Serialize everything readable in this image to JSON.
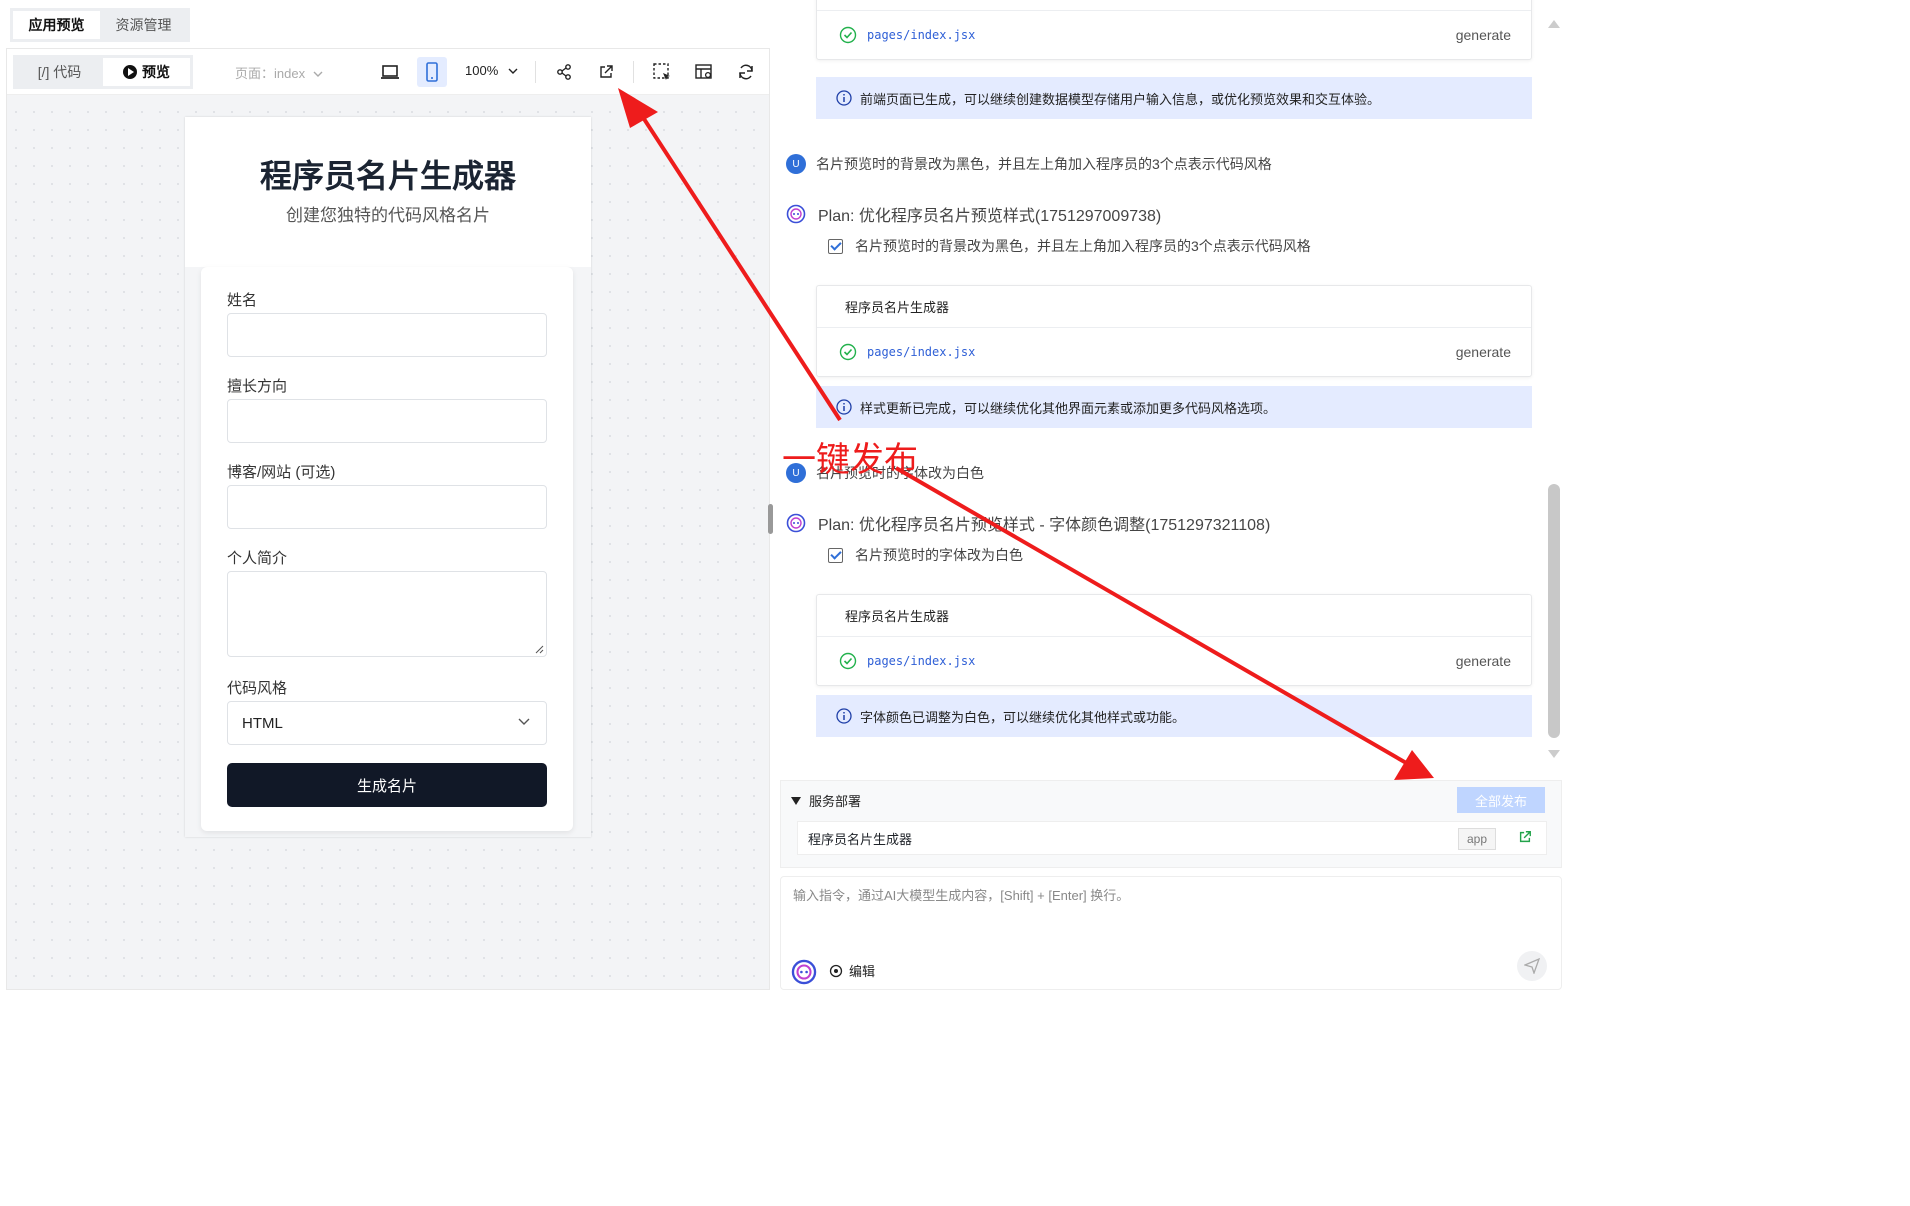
{
  "top_tabs": [
    "应用预览",
    "资源管理"
  ],
  "toolbar": {
    "code_label": "[/] 代码",
    "preview_label": "预览",
    "page_select": "页面：index",
    "zoom": "100%"
  },
  "preview": {
    "title": "程序员名片生成器",
    "subtitle": "创建您独特的代码风格名片",
    "fields": {
      "name": "姓名",
      "specialty": "擅长方向",
      "blog": "博客/网站 (可选)",
      "bio": "个人简介",
      "style": "代码风格"
    },
    "style_value": "HTML",
    "button": "生成名片"
  },
  "chat": {
    "card_title": "程序员名片生成器",
    "file": "pages/index.jsx",
    "generate": "generate",
    "info1": "前端页面已生成，可以继续创建数据模型存储用户输入信息，或优化预览效果和交互体验。",
    "user1": "名片预览时的背景改为黑色，并且左上角加入程序员的3个点表示代码风格",
    "plan1": "Plan: 优化程序员名片预览样式(1751297009738)",
    "task1": "名片预览时的背景改为黑色，并且左上角加入程序员的3个点表示代码风格",
    "info2": "样式更新已完成，可以继续优化其他界面元素或添加更多代码风格选项。",
    "user2": "名片预览时的字体改为白色",
    "plan2": "Plan: 优化程序员名片预览样式 - 字体颜色调整(1751297321108)",
    "task2": "名片预览时的字体改为白色",
    "info3": "字体颜色已调整为白色，可以继续优化其他样式或功能。",
    "avatar_letter": "U"
  },
  "deploy": {
    "header": "服务部署",
    "publish_all": "全部发布",
    "app_name": "程序员名片生成器",
    "tag": "app"
  },
  "composer": {
    "placeholder": "输入指令，通过AI大模型生成内容，[Shift] + [Enter] 换行。",
    "edit": "编辑"
  },
  "annotation": "一键发布",
  "colors": {
    "accent": "#2f6fd8",
    "info_bg": "#e4ebff",
    "annotation": "#ee1c1c",
    "primary_btn": "#111827"
  }
}
